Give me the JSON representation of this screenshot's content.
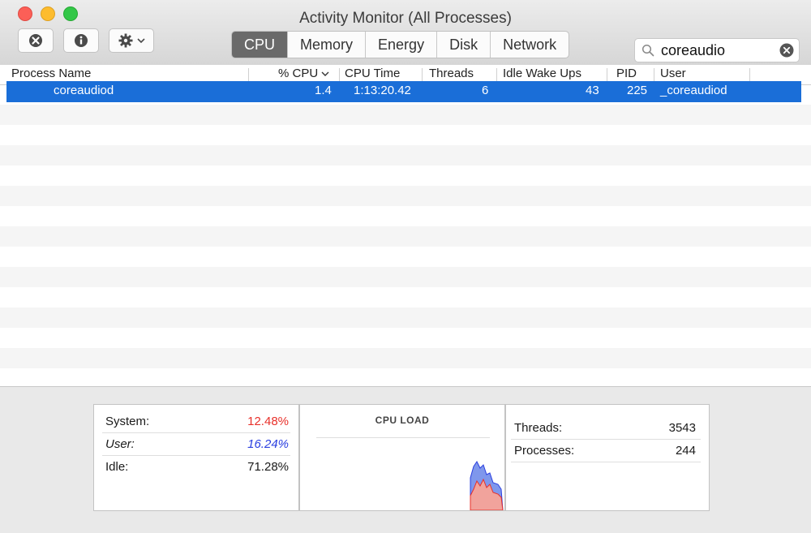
{
  "window": {
    "title": "Activity Monitor (All Processes)"
  },
  "toolbar": {
    "stop_icon": "stop-process-icon",
    "info_icon": "info-icon",
    "gear_icon": "gear-icon"
  },
  "tabs": [
    {
      "label": "CPU",
      "active": true
    },
    {
      "label": "Memory",
      "active": false
    },
    {
      "label": "Energy",
      "active": false
    },
    {
      "label": "Disk",
      "active": false
    },
    {
      "label": "Network",
      "active": false
    }
  ],
  "search": {
    "value": "coreaudio"
  },
  "columns": {
    "process_name": "Process Name",
    "cpu": "% CPU",
    "cpu_time": "CPU Time",
    "threads": "Threads",
    "idle_wake_ups": "Idle Wake Ups",
    "pid": "PID",
    "user": "User"
  },
  "process": {
    "name": "coreaudiod",
    "cpu": "1.4",
    "cpu_time": "1:13:20.42",
    "threads": "6",
    "idle_wake_ups": "43",
    "pid": "225",
    "user": "_coreaudiod"
  },
  "footer": {
    "system_label": "System:",
    "system_value": "12.48%",
    "user_label": "User:",
    "user_value": "16.24%",
    "idle_label": "Idle:",
    "idle_value": "71.28%",
    "cpu_load_title": "CPU LOAD",
    "threads_label": "Threads:",
    "threads_value": "3543",
    "processes_label": "Processes:",
    "processes_value": "244"
  },
  "colors": {
    "system": "#e8302a",
    "user": "#2a3fe0",
    "selection": "#1a6ed8"
  }
}
